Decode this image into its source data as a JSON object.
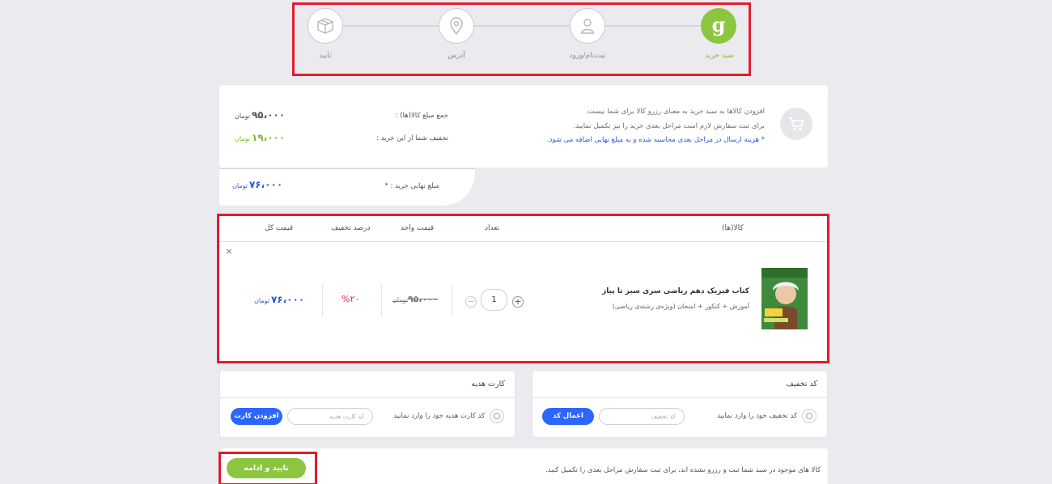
{
  "stepper": {
    "steps": [
      {
        "label": "سبد خرید",
        "icon": "g-logo-icon",
        "state": "active"
      },
      {
        "label": "ثبت‌نام/ورود",
        "icon": "user-icon",
        "state": "pending"
      },
      {
        "label": "آدرس",
        "icon": "location-pin-icon",
        "state": "pending"
      },
      {
        "label": "تایید",
        "icon": "box-icon",
        "state": "pending"
      }
    ]
  },
  "summary": {
    "info_line1": "افزودن کالاها به سبد خرید به معنای رزرو کالا برای شما نیست.",
    "info_line2": "برای ثبت سفارش لازم است مراحل بعدی خرید را نیز تکمیل نمایید.",
    "info_line3": "* هزینه ارسال در مراحل بعدی محاسبه شده و به مبلغ نهایی اضافه می شود.",
    "total_label": "جمع مبلغ کالا(ها) :",
    "total_value": "۹۵،۰۰۰",
    "discount_label": "تخفیف شما از این خرید :",
    "discount_value": "۱۹،۰۰۰",
    "final_label": "مبلغ نهایی خرید : *",
    "final_value": "۷۶،۰۰۰",
    "currency": "تومان"
  },
  "table": {
    "headers": {
      "products": "کالا(ها)",
      "quantity": "تعداد",
      "unit_price": "قیمت واحد",
      "discount_percent": "درصد تخفیف",
      "total_price": "قیمت کل"
    },
    "rows": [
      {
        "title": "کتاب فیزیک دهم ریاضی سری سیر تا پیاز",
        "subtitle": "آموزش + کنکور + امتحان (ویژه‌ی رشته‌ی ریاضی)",
        "quantity": "1",
        "unit_price": "۹۵،۰۰۰",
        "unit_currency": "تومان",
        "discount": "%۲۰",
        "total": "۷۶،۰۰۰",
        "total_currency": "تومان"
      }
    ],
    "remove_glyph": "×",
    "plus_glyph": "+",
    "minus_glyph": "−"
  },
  "coupon": {
    "title": "کد تخفیف",
    "label": "کد تخفیف خود را وارد نمایید",
    "placeholder": "کد تخفیف",
    "button": "اعمال کد"
  },
  "gift": {
    "title": "کارت هدیه",
    "label": "کد کارت هدیه خود را وارد نمایید",
    "placeholder": "کد کارت هدیه",
    "button": "افزودن کارت"
  },
  "footer": {
    "notice": "کالا های موجود در سبد شما ثبت و رزرو نشده اند، برای ثبت سفارش مراحل بعدی را تکمیل کنید.",
    "confirm_button": "تایید و ادامه"
  },
  "colors": {
    "accent_green": "#8cc63f",
    "accent_blue": "#2c66ff",
    "highlight_red": "#e21b2d",
    "discount_red": "#e0334b"
  }
}
